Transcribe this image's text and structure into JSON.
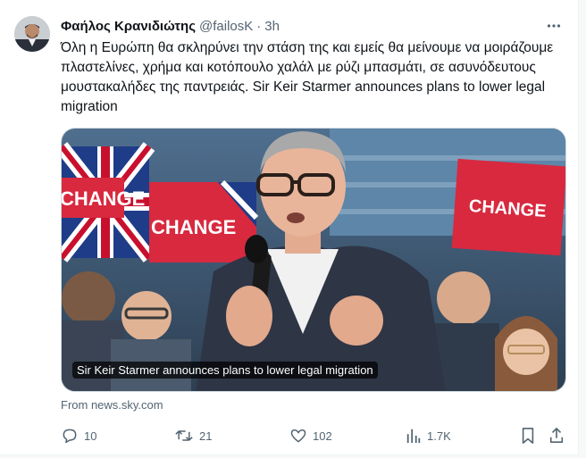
{
  "author": {
    "name": "Φαήλος Κρανιδιώτης",
    "handle": "@failosK",
    "separator": "·",
    "time": "3h"
  },
  "tweet": {
    "text": "Όλη η Ευρώπη θα σκληρύνει την στάση της και εμείς θα μείνουμε να μοιράζουμε πλαστελίνες, χρήμα και κοτόπουλο χαλάλ με ρύζι μπασμάτι, σε ασυνόδευτους μουστακαλήδες της παντρειάς. Sir Keir Starmer announces plans to lower legal migration"
  },
  "card": {
    "caption": "Sir Keir Starmer announces plans to lower legal migration",
    "source": "From news.sky.com",
    "sign_text": "CHANGE"
  },
  "actions": {
    "replies": "10",
    "reposts": "21",
    "likes": "102",
    "views": "1.7K"
  },
  "colors": {
    "text": "#0f1419",
    "secondary": "#536471",
    "sign_red": "#d8293f",
    "border": "#cfd9de"
  },
  "icons": [
    "more-icon",
    "reply-icon",
    "repost-icon",
    "like-icon",
    "views-icon",
    "bookmark-icon",
    "share-icon"
  ]
}
